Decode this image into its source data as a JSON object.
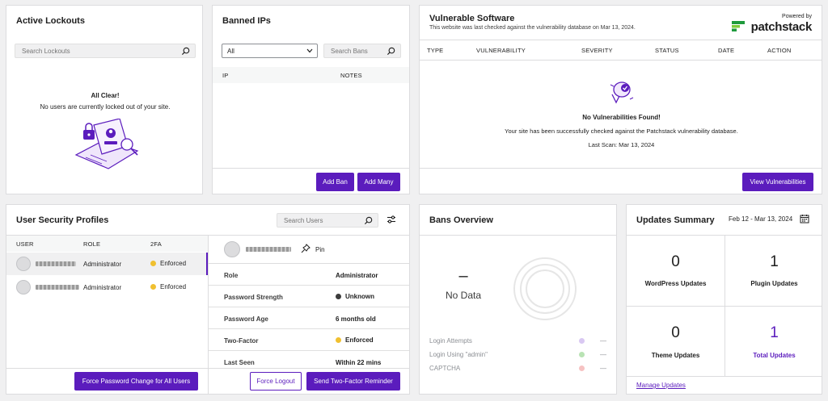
{
  "lockouts": {
    "title": "Active Lockouts",
    "search_placeholder": "Search Lockouts",
    "empty_title": "All Clear!",
    "empty_message": "No users are currently locked out of your site."
  },
  "banned": {
    "title": "Banned IPs",
    "filter_value": "All",
    "search_placeholder": "Search Bans",
    "columns": [
      "IP",
      "NOTES"
    ],
    "add_ban": "Add Ban",
    "add_many": "Add Many"
  },
  "vuln": {
    "title": "Vulnerable Software",
    "subtitle": "This website was last checked against the vulnerability database on Mar 13, 2024.",
    "powered_by": "Powered by",
    "brand": "patchstack",
    "columns": [
      "TYPE",
      "VULNERABILITY",
      "SEVERITY",
      "STATUS",
      "DATE",
      "ACTION"
    ],
    "empty_title": "No Vulnerabilities Found!",
    "empty_message": "Your site has been successfully checked against the Patchstack vulnerability database.",
    "last_scan": "Last Scan: Mar 13, 2024",
    "view_button": "View Vulnerabilities"
  },
  "profiles": {
    "title": "User Security Profiles",
    "search_placeholder": "Search Users",
    "columns": [
      "USER",
      "ROLE",
      "2FA"
    ],
    "users": [
      {
        "role": "Administrator",
        "twofa": "Enforced"
      },
      {
        "role": "Administrator",
        "twofa": "Enforced"
      }
    ],
    "force_password_button": "Force Password Change for All Users",
    "pin_label": "Pin",
    "details": [
      {
        "label": "Role",
        "value": "Administrator"
      },
      {
        "label": "Password Strength",
        "value": "Unknown"
      },
      {
        "label": "Password Age",
        "value": "6 months old"
      },
      {
        "label": "Two-Factor",
        "value": "Enforced"
      },
      {
        "label": "Last Seen",
        "value": "Within 22 mins"
      }
    ],
    "force_logout_button": "Force Logout",
    "reminder_button": "Send Two-Factor Reminder"
  },
  "bans_overview": {
    "title": "Bans Overview",
    "big_value": "–",
    "no_data": "No Data",
    "legend": [
      {
        "label": "Login Attempts",
        "value": "—",
        "color": "#d9c8f2"
      },
      {
        "label": "Login Using \"admin\"",
        "value": "—",
        "color": "#b9e3b4"
      },
      {
        "label": "CAPTCHA",
        "value": "—",
        "color": "#f6c2c2"
      }
    ]
  },
  "updates": {
    "title": "Updates Summary",
    "date_range": "Feb 12 - Mar 13, 2024",
    "cells": [
      {
        "value": "0",
        "label": "WordPress Updates"
      },
      {
        "value": "1",
        "label": "Plugin Updates"
      },
      {
        "value": "0",
        "label": "Theme Updates"
      },
      {
        "value": "1",
        "label": "Total Updates"
      }
    ],
    "manage_link": "Manage Updates"
  },
  "colors": {
    "accent": "#5b1cbd",
    "enforced": "#f0c030",
    "unknown": "#3c3c3c",
    "brand_green": "#1e9a3c"
  }
}
